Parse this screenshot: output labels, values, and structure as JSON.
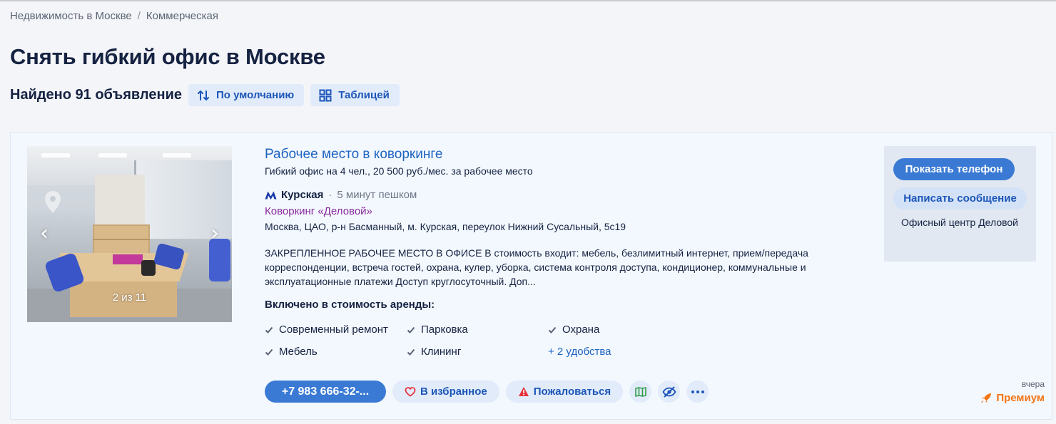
{
  "breadcrumbs": [
    "Недвижимость в Москве",
    "Коммерческая"
  ],
  "breadcrumb_separator": "/",
  "page_title": "Снять гибкий офис в Москве",
  "results": {
    "found_label": "Найдено 91 объявление",
    "sort_label": "По умолчанию",
    "view_label": "Таблицей"
  },
  "listing": {
    "photo_counter": "2 из 11",
    "title": "Рабочее место в коворкинге",
    "subtitle": "Гибкий офис на 4 чел., 20 500 руб./мес. за рабочее место",
    "metro": {
      "station": "Курская",
      "separator": "·",
      "time": "5 минут пешком",
      "icon_color": "#1a3aa8"
    },
    "coworking_link": "Коворкинг «Деловой»",
    "address": "Москва, ЦАО, р-н Басманный, м. Курская, переулок Нижний Сусальный, 5с19",
    "description": "ЗАКРЕПЛЕННОЕ РАБОЧЕЕ МЕСТО В ОФИСЕ В стоимость входит: мебель, безлимитный интернет, прием/передача корреспонденции, встреча гостей, охрана, кулер, уборка, система контроля доступа, кондиционер, коммунальные и эксплуатационные платежи Доступ круглосуточный. Доп...",
    "included_title": "Включено в стоимость аренды:",
    "amenities": [
      "Современный ремонт",
      "Парковка",
      "Охрана",
      "Мебель",
      "Клининг"
    ],
    "amenities_more": "+ 2 удобства",
    "actions": {
      "phone": "+7 983 666-32-...",
      "favorite": "В избранное",
      "complain": "Пожаловаться"
    },
    "date": "вчера",
    "premium_label": "Премиум"
  },
  "sidebar": {
    "show_phone": "Показать телефон",
    "write_message": "Написать сообщение",
    "company": "Офисный центр Деловой"
  },
  "colors": {
    "accent": "#3a7ad4",
    "link": "#1e63c0",
    "coworking_link": "#8a2a9e",
    "premium": "#f27414",
    "complain_icon": "#e8313b",
    "favorite_icon": "#e8313b",
    "map_icon": "#2e9b48"
  },
  "icons": {
    "sort": "sort-arrows-icon",
    "view": "grid-icon",
    "metro": "metro-icon",
    "check": "check-icon",
    "favorite": "heart-icon",
    "complain": "warning-icon",
    "map": "map-icon",
    "hide": "eye-off-icon",
    "more": "more-dots-icon",
    "premium": "rocket-icon"
  }
}
